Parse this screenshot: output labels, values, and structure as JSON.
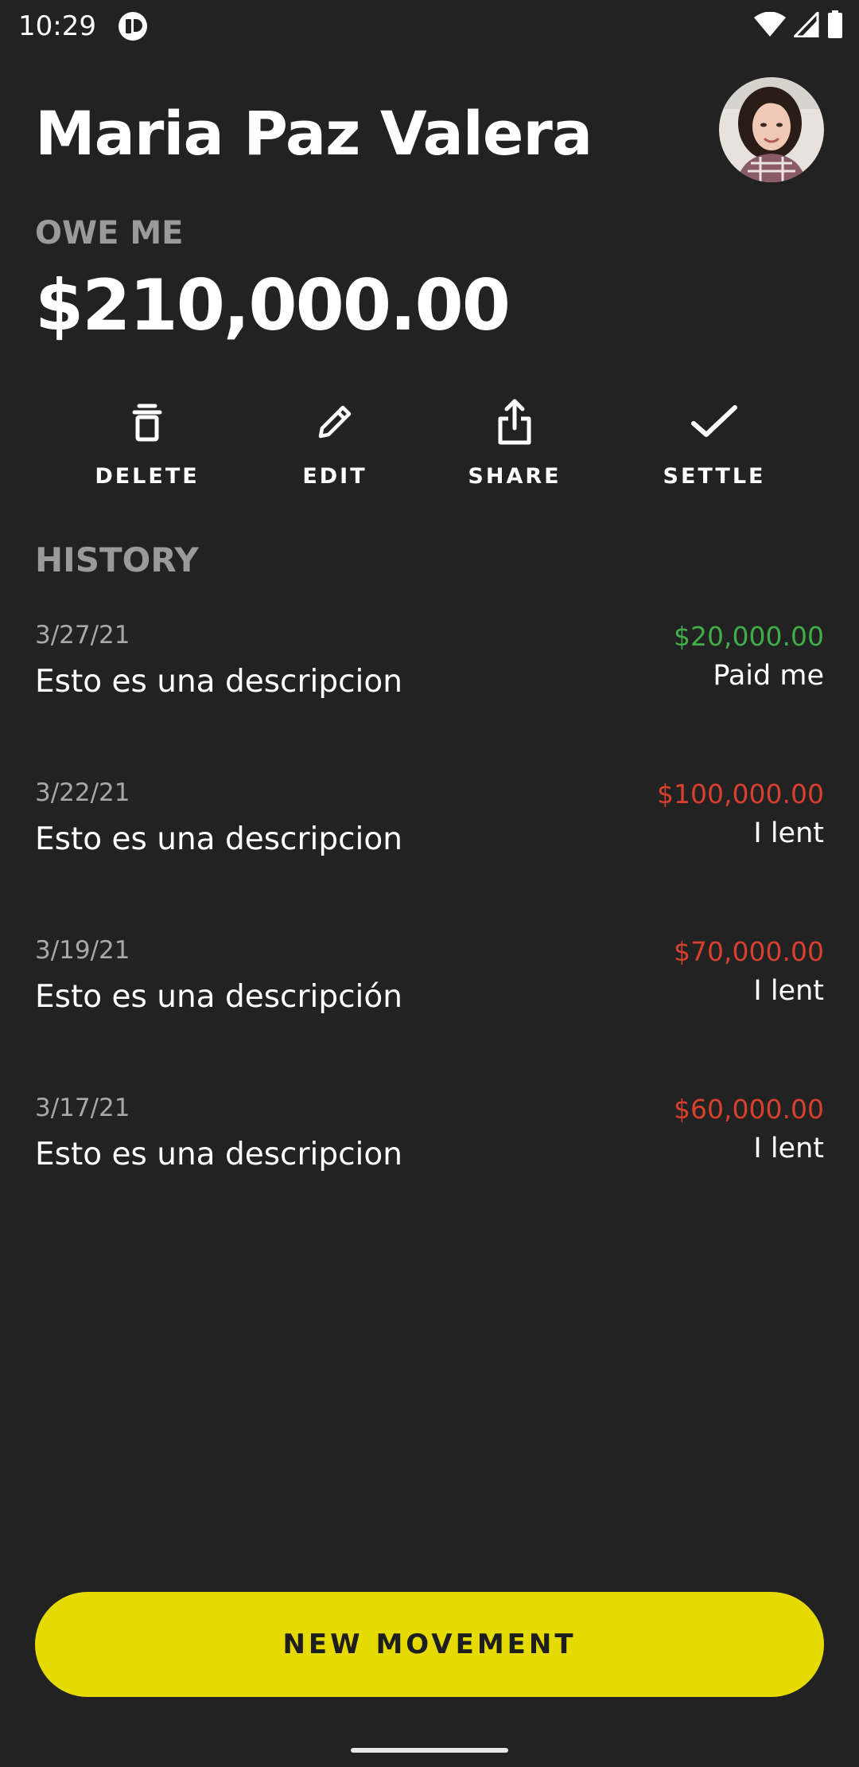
{
  "status_bar": {
    "time": "10:29",
    "icons": [
      "app-notification-icon",
      "wifi-icon",
      "signal-icon",
      "battery-icon"
    ]
  },
  "contact": {
    "name": "Maria Paz Valera",
    "balance_label": "OWE ME",
    "balance": "$210,000.00"
  },
  "actions": {
    "delete": "DELETE",
    "edit": "EDIT",
    "share": "SHARE",
    "settle": "SETTLE"
  },
  "history": {
    "title": "HISTORY",
    "items": [
      {
        "date": "3/27/21",
        "description": "Esto es una descripcion",
        "amount": "$20,000.00",
        "type": "Paid me",
        "amount_color": "#3fae49"
      },
      {
        "date": "3/22/21",
        "description": "Esto es una descripcion",
        "amount": "$100,000.00",
        "type": "I lent",
        "amount_color": "#d8402e"
      },
      {
        "date": "3/19/21",
        "description": "Esto es una descripción",
        "amount": "$70,000.00",
        "type": "I lent",
        "amount_color": "#d8402e"
      },
      {
        "date": "3/17/21",
        "description": "Esto es una descripcion",
        "amount": "$60,000.00",
        "type": "I lent",
        "amount_color": "#d8402e"
      }
    ]
  },
  "new_movement_label": "NEW MOVEMENT",
  "colors": {
    "background": "#222222",
    "accent": "#e5db00",
    "positive": "#3fae49",
    "negative": "#d8402e",
    "muted": "#9a9a9a"
  }
}
